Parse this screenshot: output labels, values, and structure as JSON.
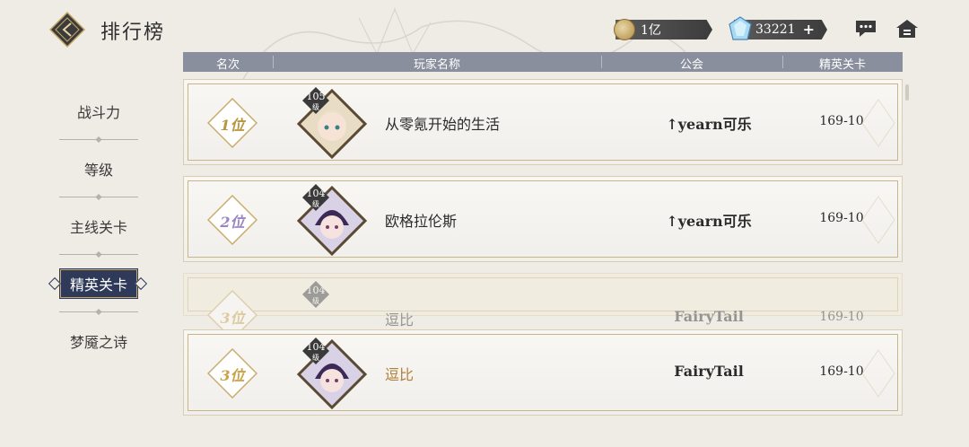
{
  "header": {
    "title": "排行榜",
    "gold_amount": "1亿",
    "gem_amount": "33221"
  },
  "sidebar": {
    "items": [
      {
        "label": "战斗力"
      },
      {
        "label": "等级"
      },
      {
        "label": "主线关卡"
      },
      {
        "label": "精英关卡",
        "active": true
      },
      {
        "label": "梦魇之诗"
      }
    ]
  },
  "table": {
    "columns": [
      "名次",
      "玩家名称",
      "公会",
      "精英关卡"
    ],
    "rows": [
      {
        "rank": "1位",
        "level": "105",
        "level_unit": "级",
        "name": "从零氪开始的生活",
        "guild": "↑yearn可乐",
        "stage": "169-10",
        "rank_color": "#b8953f"
      },
      {
        "rank": "2位",
        "level": "104",
        "level_unit": "级",
        "name": "欧格拉伦斯",
        "guild": "↑yearn可乐",
        "stage": "169-10",
        "rank_color": "#9b86c4"
      },
      {
        "rank": "3位",
        "level": "104",
        "level_unit": "级",
        "name": "逗比",
        "guild": "FairyTail",
        "stage": "169-10",
        "rank_color": "#c9a24a"
      },
      {
        "rank": "3位",
        "level": "104",
        "level_unit": "级",
        "name": "逗比",
        "guild": "FairyTail",
        "stage": "169-10",
        "rank_color": "#7fa6c9"
      }
    ]
  }
}
